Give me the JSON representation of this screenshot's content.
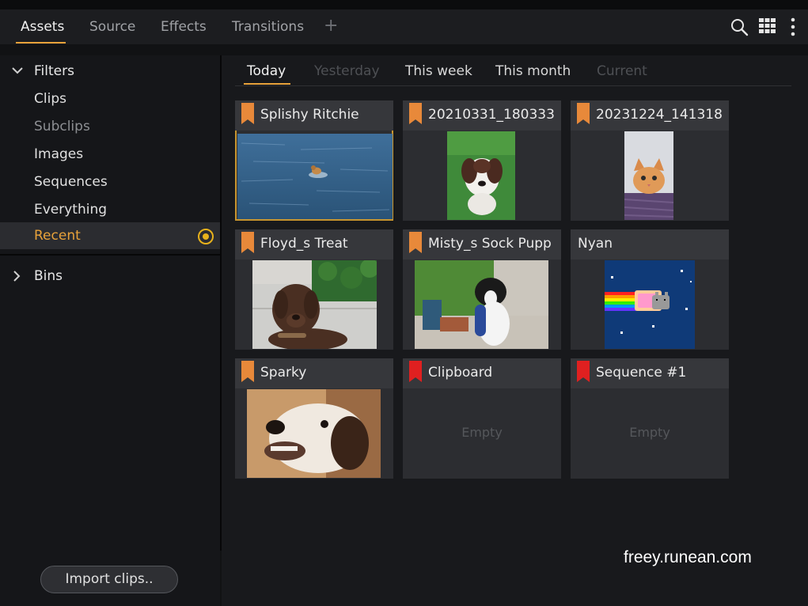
{
  "top_tabs": [
    {
      "label": "Assets",
      "active": true
    },
    {
      "label": "Source",
      "active": false
    },
    {
      "label": "Effects",
      "active": false
    },
    {
      "label": "Transitions",
      "active": false
    }
  ],
  "top_icons": [
    "plus-icon",
    "search-icon",
    "grid-view-icon",
    "more-vertical-icon"
  ],
  "sidebar": {
    "filters_label": "Filters",
    "items": [
      "Clips",
      "Subclips",
      "Images",
      "Sequences",
      "Everything"
    ],
    "recent_label": "Recent",
    "bins_label": "Bins",
    "import_button": "Import clips.."
  },
  "sub_tabs": [
    {
      "label": "Today",
      "state": "active"
    },
    {
      "label": "Yesterday",
      "state": "disabled"
    },
    {
      "label": "This week",
      "state": "normal"
    },
    {
      "label": "This month",
      "state": "normal"
    },
    {
      "label": "Current",
      "state": "disabled"
    }
  ],
  "cards": [
    {
      "title": "Splishy Ritchie",
      "flag": "orange",
      "selected": true,
      "empty_label": ""
    },
    {
      "title": "20210331_180333",
      "flag": "orange",
      "selected": false,
      "empty_label": ""
    },
    {
      "title": "20231224_141318",
      "flag": "orange",
      "selected": false,
      "empty_label": ""
    },
    {
      "title": "Floyd_s Treat",
      "flag": "orange",
      "selected": false,
      "empty_label": ""
    },
    {
      "title": "Misty_s Sock Pupp",
      "flag": "orange",
      "selected": false,
      "empty_label": ""
    },
    {
      "title": "Nyan",
      "flag": "none",
      "selected": false,
      "empty_label": ""
    },
    {
      "title": "Sparky",
      "flag": "orange",
      "selected": false,
      "empty_label": ""
    },
    {
      "title": "Clipboard",
      "flag": "red",
      "selected": false,
      "empty_label": "Empty"
    },
    {
      "title": "Sequence #1",
      "flag": "red",
      "selected": false,
      "empty_label": "Empty"
    }
  ],
  "colors": {
    "accent": "#e8a23a",
    "flag_orange": "#e8893a",
    "flag_red": "#e02020",
    "recent_radio": "#e8b21c"
  },
  "watermark": "freey.runean.com"
}
